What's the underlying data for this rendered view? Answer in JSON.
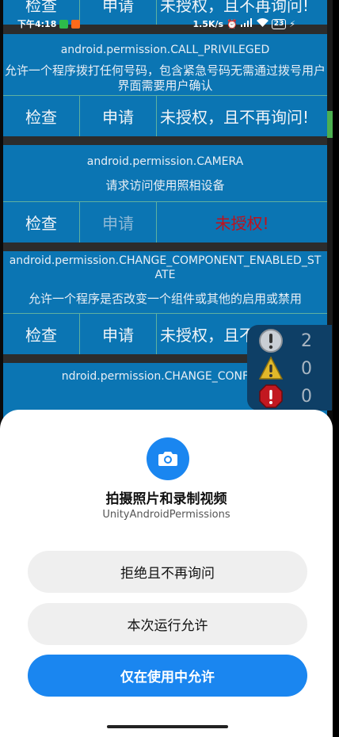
{
  "status_bar": {
    "time": "下午4:18",
    "speed": "1.5K/s",
    "battery": "23"
  },
  "top_row": {
    "check": "检查",
    "apply": "申请",
    "status": "未授权，且不再询问!"
  },
  "permissions": [
    {
      "name": "android.permission.CALL_PRIVILEGED",
      "desc": "允许一个程序拨打任何号码，包含紧急号码无需通过拨号用户界面需要用户确认",
      "check": "检查",
      "apply": "申请",
      "status": "未授权，且不再询问!"
    },
    {
      "name": "android.permission.CAMERA",
      "desc": "请求访问使用照相设备",
      "check": "检查",
      "apply": "申请",
      "status": "未授权!"
    },
    {
      "name": "android.permission.CHANGE_COMPONENT_ENABLED_STATE",
      "desc": "允许一个程序是否改变一个组件或其他的启用或禁用",
      "check": "检查",
      "apply": "申请",
      "status": "未授权，且不再询问!"
    },
    {
      "name": "ndroid.permission.CHANGE_CONFIGU"
    }
  ],
  "counters": {
    "info": "2",
    "warning": "0",
    "error": "0"
  },
  "dialog": {
    "title": "拍摄照片和录制视频",
    "subtitle": "UnityAndroidPermissions",
    "deny": "拒绝且不再询问",
    "allow_once": "本次运行允许",
    "allow_while_using": "仅在使用中允许"
  },
  "colors": {
    "list_bg": "#0b75b3",
    "accent": "#1a86f0",
    "denied_red": "#c0101a"
  }
}
